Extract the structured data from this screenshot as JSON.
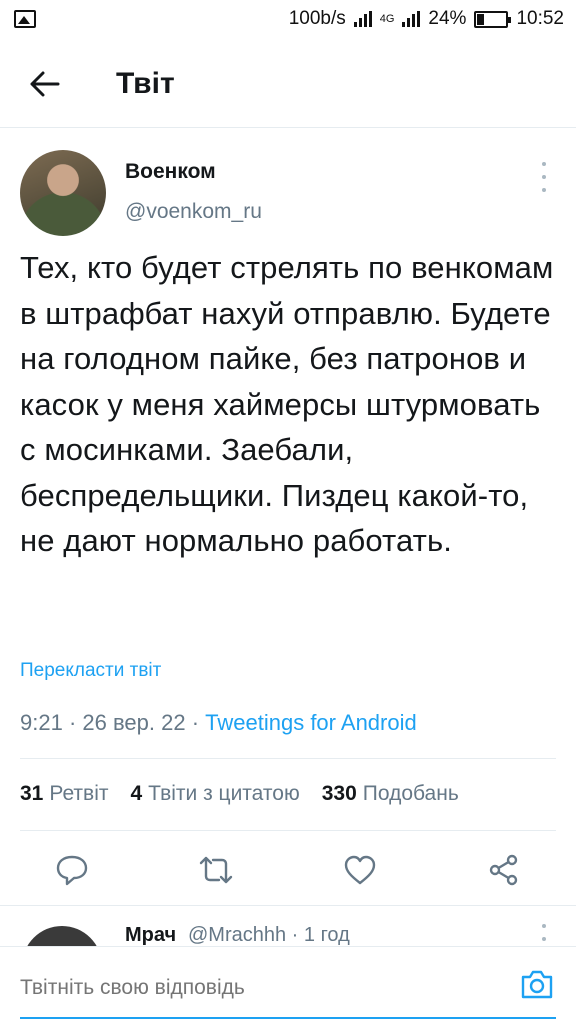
{
  "status_bar": {
    "speed": "100b/s",
    "network": "4G",
    "battery": "24%",
    "time": "10:52"
  },
  "header": {
    "title": "Твіт"
  },
  "tweet": {
    "author_name": "Военком",
    "author_handle": "@voenkom_ru",
    "text": "Тех, кто будет стрелять по венкомам в штрафбат нахуй отправлю. Будете на голодном пайке, без патронов и касок у меня хаймерсы штурмовать с мосинками. Заебали, беспредельщики. Пиздец какой-то, не дают нормально работать.",
    "translate_label": "Перекласти твіт",
    "time": "9:21",
    "date": "26 вер. 22",
    "client": "Tweetings for Android"
  },
  "stats": {
    "retweets_count": "31",
    "retweets_label": "Ретвіт",
    "quotes_count": "4",
    "quotes_label": "Твіти з цитатою",
    "likes_count": "330",
    "likes_label": "Подобань"
  },
  "reply_preview": {
    "name": "Мрач",
    "handle_time": "@Mrachhh · 1 год"
  },
  "compose": {
    "placeholder": "Твітніть свою відповідь"
  },
  "colors": {
    "accent": "#1da1f2",
    "secondary_text": "#657786",
    "divider": "#e6ecf0"
  },
  "icons": [
    "back-arrow-icon",
    "more-vertical-icon",
    "reply-icon",
    "retweet-icon",
    "like-icon",
    "share-icon",
    "camera-icon"
  ]
}
